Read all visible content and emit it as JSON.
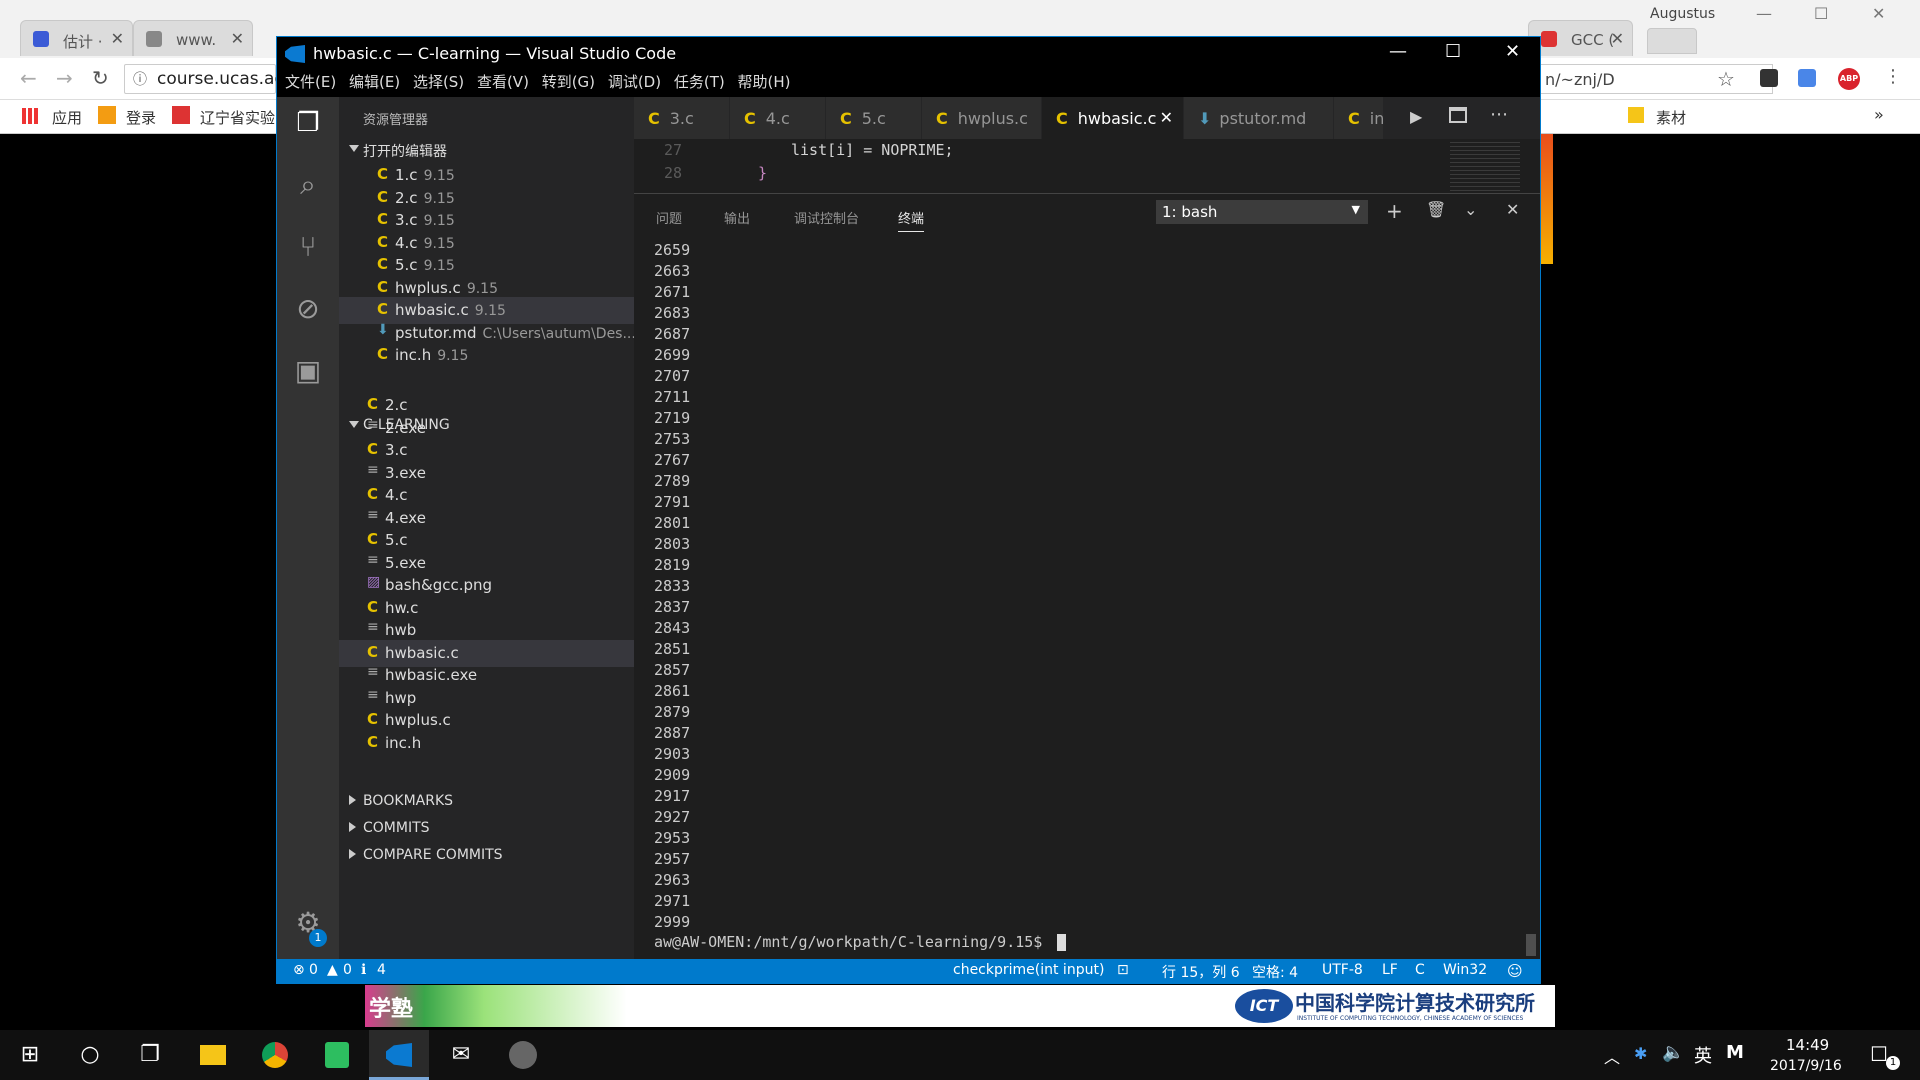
{
  "chrome": {
    "tabs": [
      {
        "label": "估计 ·"
      },
      {
        "label": "www."
      },
      {
        "label": ""
      },
      {
        "label": ""
      },
      {
        "label": ""
      },
      {
        "label": ""
      },
      {
        "label": ""
      },
      {
        "label": ""
      },
      {
        "label": ""
      },
      {
        "label": ""
      },
      {
        "label": ""
      },
      {
        "label": ""
      },
      {
        "label": ""
      },
      {
        "label": "GCC ("
      }
    ],
    "profile_name": "Augustus",
    "url_text": "course.ucas.ac",
    "url_right_text": "n/~znj/D",
    "bookmarks": {
      "apps": "应用",
      "login": "登录",
      "liaoning": "辽宁省实验",
      "sucai": "素材",
      "more": "»"
    }
  },
  "vscode": {
    "title": "hwbasic.c — C-learning — Visual Studio Code",
    "menu": [
      "文件(E)",
      "编辑(E)",
      "选择(S)",
      "查看(V)",
      "转到(G)",
      "调试(D)",
      "任务(T)",
      "帮助(H)"
    ],
    "sidebar_title": "资源管理器",
    "open_editors_header": "打开的编辑器",
    "open_editors": [
      {
        "name": "1.c",
        "desc": "9.15",
        "icon": "c"
      },
      {
        "name": "2.c",
        "desc": "9.15",
        "icon": "c"
      },
      {
        "name": "3.c",
        "desc": "9.15",
        "icon": "c"
      },
      {
        "name": "4.c",
        "desc": "9.15",
        "icon": "c"
      },
      {
        "name": "5.c",
        "desc": "9.15",
        "icon": "c"
      },
      {
        "name": "hwplus.c",
        "desc": "9.15",
        "icon": "c"
      },
      {
        "name": "hwbasic.c",
        "desc": "9.15",
        "icon": "c"
      },
      {
        "name": "pstutor.md",
        "desc": "C:\\Users\\autum\\Des...",
        "icon": "md"
      },
      {
        "name": "inc.h",
        "desc": "9.15",
        "icon": "c"
      }
    ],
    "project_header": "C-LEARNING",
    "project_files": [
      {
        "name": "2.c",
        "icon": "c"
      },
      {
        "name": "2.exe",
        "icon": "file"
      },
      {
        "name": "3.c",
        "icon": "c"
      },
      {
        "name": "3.exe",
        "icon": "file"
      },
      {
        "name": "4.c",
        "icon": "c"
      },
      {
        "name": "4.exe",
        "icon": "file"
      },
      {
        "name": "5.c",
        "icon": "c"
      },
      {
        "name": "5.exe",
        "icon": "file"
      },
      {
        "name": "bash&gcc.png",
        "icon": "image"
      },
      {
        "name": "hw.c",
        "icon": "c"
      },
      {
        "name": "hwb",
        "icon": "file"
      },
      {
        "name": "hwbasic.c",
        "icon": "c"
      },
      {
        "name": "hwbasic.exe",
        "icon": "file"
      },
      {
        "name": "hwp",
        "icon": "file"
      },
      {
        "name": "hwplus.c",
        "icon": "c"
      },
      {
        "name": "inc.h",
        "icon": "c"
      }
    ],
    "collapsed_sections": [
      "BOOKMARKS",
      "COMMITS",
      "COMPARE COMMITS"
    ],
    "settings_badge": "1",
    "editor_tabs": [
      "3.c",
      "4.c",
      "5.c",
      "hwplus.c",
      "hwbasic.c",
      "pstutor.md",
      "in"
    ],
    "code_lines": [
      {
        "num": "27",
        "text": "list[i] = NOPRIME;"
      },
      {
        "num": "28",
        "text": "}"
      }
    ],
    "panel_tabs": [
      "问题",
      "输出",
      "调试控制台",
      "终端"
    ],
    "terminal_select": "1: bash",
    "terminal_output": [
      "2659",
      "2663",
      "2671",
      "2683",
      "2687",
      "2699",
      "2707",
      "2711",
      "2719",
      "2753",
      "2767",
      "2789",
      "2791",
      "2801",
      "2803",
      "2819",
      "2833",
      "2837",
      "2843",
      "2851",
      "2857",
      "2861",
      "2879",
      "2887",
      "2903",
      "2909",
      "2917",
      "2927",
      "2953",
      "2957",
      "2963",
      "2971",
      "2999"
    ],
    "prompt": "aw@AW-OMEN:/mnt/g/workpath/C-learning/9.15$",
    "status": {
      "errors": "0",
      "warnings": "0",
      "infos": "4",
      "function": "checkprime(int input)",
      "position": "行 15，列 6",
      "spaces": "空格: 4",
      "encoding": "UTF-8",
      "eol": "LF",
      "language": "C",
      "platform": "Win32"
    }
  },
  "banner": {
    "left_text": "学塾",
    "ict_logo": "ICT",
    "ict_cn": "中国科学院计算技术研究所",
    "ict_en": "INSTITUTE OF COMPUTING TECHNOLOGY, CHINESE ACADEMY OF SCIENCES"
  },
  "taskbar": {
    "ime": "英",
    "time": "14:49",
    "date": "2017/9/16",
    "notif_badge": "1"
  },
  "colors": {
    "accent": "#007acc",
    "c_icon": "#e5c100",
    "titlebar": "#000000"
  }
}
